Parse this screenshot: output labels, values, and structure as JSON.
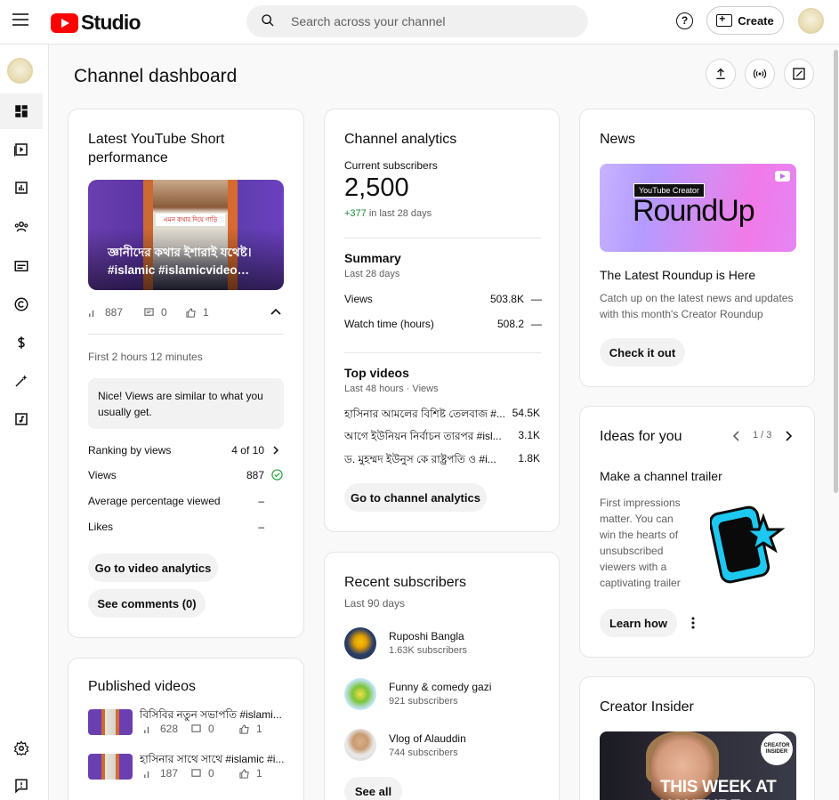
{
  "header": {
    "brand": "Studio",
    "search_placeholder": "Search across your channel",
    "help_glyph": "?",
    "create_label": "Create"
  },
  "sidebar": {
    "items": [
      {
        "name": "dashboard",
        "icon": "dashboard-icon"
      },
      {
        "name": "content",
        "icon": "content-icon"
      },
      {
        "name": "analytics",
        "icon": "analytics-icon"
      },
      {
        "name": "community",
        "icon": "community-icon"
      },
      {
        "name": "subtitles",
        "icon": "subtitles-icon"
      },
      {
        "name": "copyright",
        "icon": "copyright-icon"
      },
      {
        "name": "earn",
        "icon": "dollar-icon"
      },
      {
        "name": "customization",
        "icon": "magic-wand-icon"
      },
      {
        "name": "audio-library",
        "icon": "audio-library-icon"
      }
    ],
    "bottom": [
      {
        "name": "settings",
        "icon": "gear-icon"
      },
      {
        "name": "feedback",
        "icon": "feedback-icon"
      }
    ]
  },
  "page": {
    "title": "Channel dashboard"
  },
  "short_card": {
    "title": "Latest YouTube Short performance",
    "caption": "জ্ঞানীদের কথার ইশারাই যথেষ্ট। #islamic #islamicvideo…",
    "thumb_text": "এমন কথার দিয়ে গাড়ি",
    "views": "887",
    "comments": "0",
    "likes": "1",
    "since": "First 2 hours 12 minutes",
    "note": "Nice! Views are similar to what you usually get.",
    "rows": [
      {
        "label": "Ranking by views",
        "value": "4 of 10"
      },
      {
        "label": "Views",
        "value": "887"
      },
      {
        "label": "Average percentage viewed",
        "value": "–"
      },
      {
        "label": "Likes",
        "value": "–"
      }
    ],
    "analytics_btn": "Go to video analytics",
    "comments_btn": "See comments (0)"
  },
  "analytics_card": {
    "title": "Channel analytics",
    "subs_label": "Current subscribers",
    "subs_value": "2,500",
    "subs_delta": "+377",
    "subs_delta_suffix": " in last 28 days",
    "summary_title": "Summary",
    "summary_sub": "Last 28 days",
    "summary_rows": [
      {
        "label": "Views",
        "value": "503.8K",
        "trend": "—"
      },
      {
        "label": "Watch time (hours)",
        "value": "508.2",
        "trend": "—"
      }
    ],
    "top_title": "Top videos",
    "top_sub": "Last 48 hours · Views",
    "top_rows": [
      {
        "label": "হাসিনার আমলের বিশিষ্ট তেলবাজ #...",
        "value": "54.5K"
      },
      {
        "label": "আগে ইউনিয়ন নির্বাচন তারপর #isl...",
        "value": "3.1K"
      },
      {
        "label": "ড. মুহম্মদ ইউনুস কে রাষ্ট্রপতি ও #i...",
        "value": "1.8K"
      }
    ],
    "button": "Go to channel analytics"
  },
  "subs_card": {
    "title": "Recent subscribers",
    "sub": "Last 90 days",
    "items": [
      {
        "name": "Ruposhi Bangla",
        "count": "1.63K subscribers"
      },
      {
        "name": "Funny & comedy gazi",
        "count": "921 subscribers"
      },
      {
        "name": "Vlog of Alauddin",
        "count": "744 subscribers"
      }
    ],
    "button": "See all"
  },
  "news_card": {
    "title": "News",
    "img_tag": "YouTube Creator",
    "img_big": "RoundUp",
    "headline": "The Latest Roundup is Here",
    "body": "Catch up on the latest news and updates with this month's Creator Roundup",
    "button": "Check it out"
  },
  "ideas_card": {
    "title": "Ideas for you",
    "pager": "1 / 3",
    "headline": "Make a channel trailer",
    "body": "First impressions matter. You can win the hearts of unsubscribed viewers with a captivating trailer",
    "button": "Learn how"
  },
  "published_card": {
    "title": "Published videos",
    "items": [
      {
        "title": "বিসিবির নতুন সভাপতি #islami...",
        "views": "628",
        "comments": "0",
        "likes": "1"
      },
      {
        "title": "হাসিনার সাথে সাথে #islamic #i...",
        "views": "187",
        "comments": "0",
        "likes": "1"
      }
    ]
  },
  "insider_card": {
    "title": "Creator Insider",
    "badge": "CREATOR INSIDER",
    "img_text": "THIS WEEK AT YOUTUBE"
  },
  "colors": {
    "brand_red": "#ff0000",
    "delta_green": "#1b8a3a",
    "check_green": "#2ba640",
    "trailer_cyan": "#1ec8f0"
  }
}
